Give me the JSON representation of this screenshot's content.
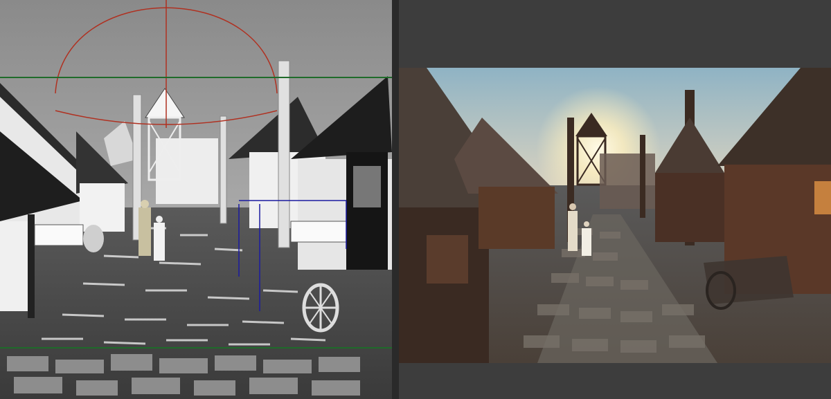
{
  "window": {
    "left_viewport": {
      "mode": "viewport-clay-render",
      "background_color": "#7a7a7a",
      "safe_frame_color": "#1f6b2a",
      "camera_gizmo_color": "#b03020",
      "selection_color": "#1a1aa0"
    },
    "divider": {
      "color": "#2a2a2a"
    },
    "right_viewport": {
      "mode": "final-render-preview",
      "background_color": "#3d3d3d",
      "sky_color": "#a9c3cf",
      "sun_color": "#fff3c8",
      "wood_color": "#5a3a28"
    }
  }
}
